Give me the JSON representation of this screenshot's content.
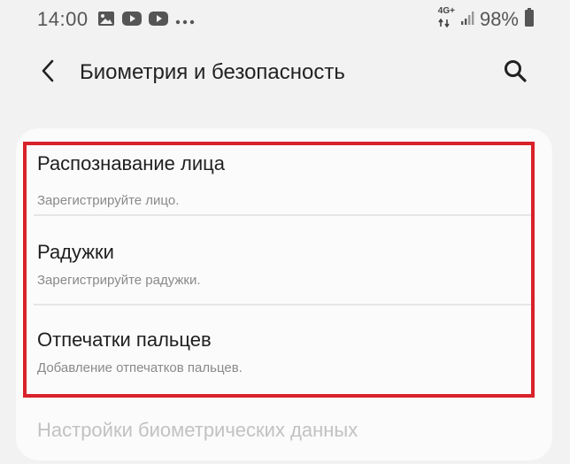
{
  "status_bar": {
    "time": "14:00",
    "network_top": "4G+",
    "battery": "98%",
    "icons": [
      "gallery-icon",
      "youtube-icon",
      "youtube-icon",
      "more-dots-icon",
      "data-arrows-icon",
      "signal-icon",
      "battery-icon"
    ]
  },
  "app_bar": {
    "title": "Биометрия и безопасность",
    "back_icon": "back-arrow-icon",
    "search_icon": "search-icon"
  },
  "list": {
    "items": [
      {
        "title": "Распознавание лица",
        "subtitle": "Зарегистрируйте лицо."
      },
      {
        "title": "Радужки",
        "subtitle": "Зарегистрируйте радужки."
      },
      {
        "title": "Отпечатки пальцев",
        "subtitle": "Добавление отпечатков пальцев."
      }
    ],
    "disabled_item": "Настройки биометрических данных"
  },
  "colors": {
    "background": "#f2f2f2",
    "card": "#fbfbfb",
    "highlight": "#d9222a",
    "disabled_text": "#c2c2c2"
  }
}
